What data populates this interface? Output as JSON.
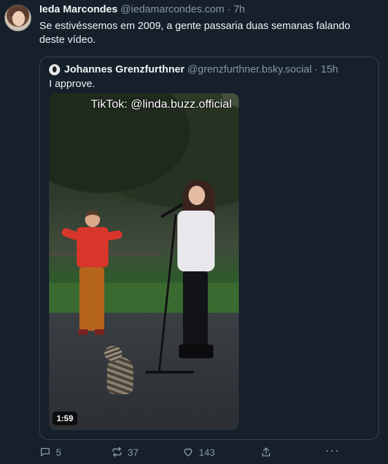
{
  "post": {
    "author": "Ieda Marcondes",
    "handle": "@iedamarcondes.com",
    "separator": "·",
    "time": "7h",
    "text_line1": "Se estivéssemos em 2009, a gente passaria duas semanas falando",
    "text_line2": "deste vídeo."
  },
  "quote": {
    "author": "Johannes Grenzfurthner",
    "handle": "@grenzfurthner.bsky.social",
    "separator": "·",
    "time": "15h",
    "text": "I approve.",
    "video": {
      "watermark": "TikTok: @linda.buzz.official",
      "duration": "1:59"
    }
  },
  "actions": {
    "reply_count": "5",
    "repost_count": "37",
    "like_count": "143",
    "more_label": "···",
    "icons": [
      "comment-icon",
      "repost-icon",
      "heart-icon",
      "share-icon",
      "more-icon"
    ]
  },
  "colors": {
    "background": "#15202b",
    "muted": "#8b98a5",
    "border": "#38444d"
  }
}
